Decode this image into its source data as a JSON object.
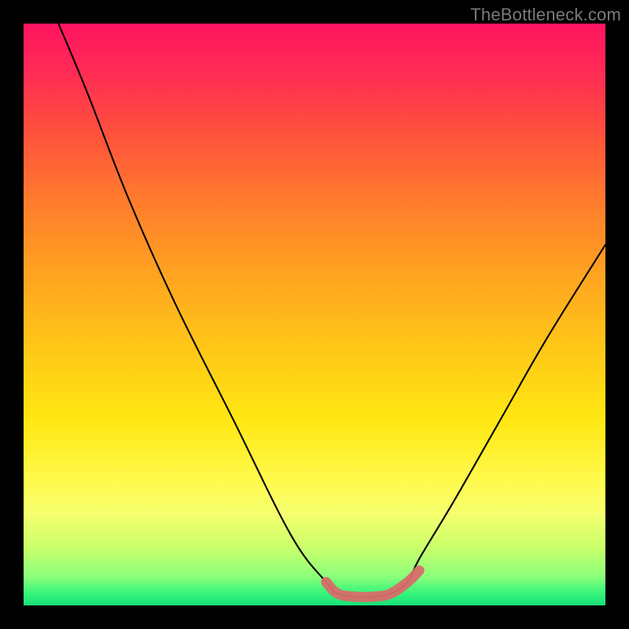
{
  "watermark": {
    "text": "TheBottleneck.com"
  },
  "colors": {
    "curve_stroke": "#000000",
    "bottom_segment_stroke": "#d86d6a",
    "frame_bg": "#000000"
  },
  "chart_data": {
    "type": "line",
    "title": "",
    "xlabel": "",
    "ylabel": "",
    "xlim": [
      0,
      100
    ],
    "ylim": [
      0,
      100
    ],
    "grid": false,
    "legend": false,
    "series": [
      {
        "name": "bottleneck-curve",
        "x": [
          6,
          11,
          18,
          26,
          36,
          46,
          52,
          54,
          57,
          60,
          63,
          66,
          68,
          74,
          82,
          90,
          100
        ],
        "y": [
          100,
          88,
          70,
          52,
          32,
          12,
          4,
          2,
          1.5,
          1.5,
          2,
          4,
          8,
          18,
          32,
          46,
          62
        ]
      },
      {
        "name": "bottom-highlight",
        "x": [
          52,
          54,
          57,
          60,
          63,
          66,
          68
        ],
        "y": [
          4,
          2,
          1.5,
          1.5,
          2,
          4,
          6
        ]
      }
    ]
  }
}
